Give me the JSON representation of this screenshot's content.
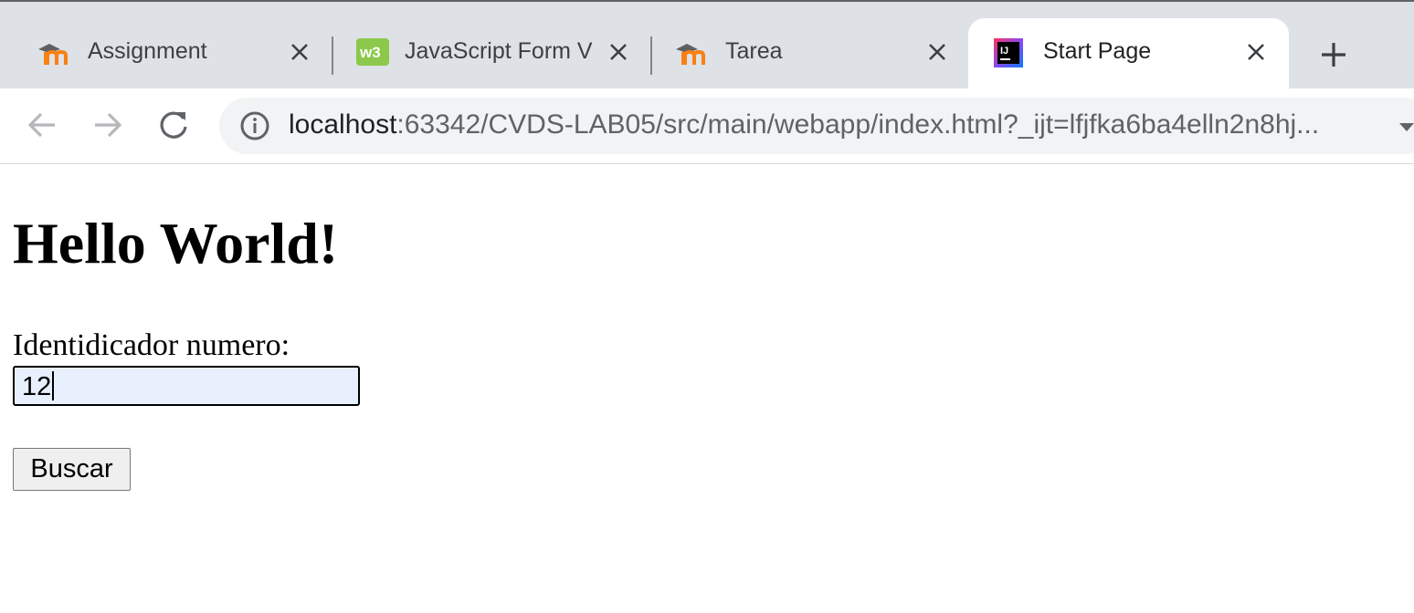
{
  "browser": {
    "tabs": [
      {
        "title": "Assignment",
        "favicon": "moodle-icon",
        "active": false
      },
      {
        "title": "JavaScript Form V",
        "favicon": "w3schools-icon",
        "active": false
      },
      {
        "title": "Tarea",
        "favicon": "moodle-icon",
        "active": false
      },
      {
        "title": "Start Page",
        "favicon": "intellij-icon",
        "active": true
      }
    ],
    "address": {
      "host": "localhost",
      "rest": ":63342/CVDS-LAB05/src/main/webapp/index.html?_ijt=lfjfka6ba4elln2n8hj..."
    }
  },
  "page": {
    "heading": "Hello World!",
    "field_label": "Identidicador numero:",
    "field_value": "12",
    "button_label": "Buscar"
  },
  "colors": {
    "tabstrip_bg": "#dee1e6",
    "omnibox_bg": "#f1f3f4",
    "input_autofill_bg": "#e8f0fe",
    "button_bg": "#efefef"
  }
}
